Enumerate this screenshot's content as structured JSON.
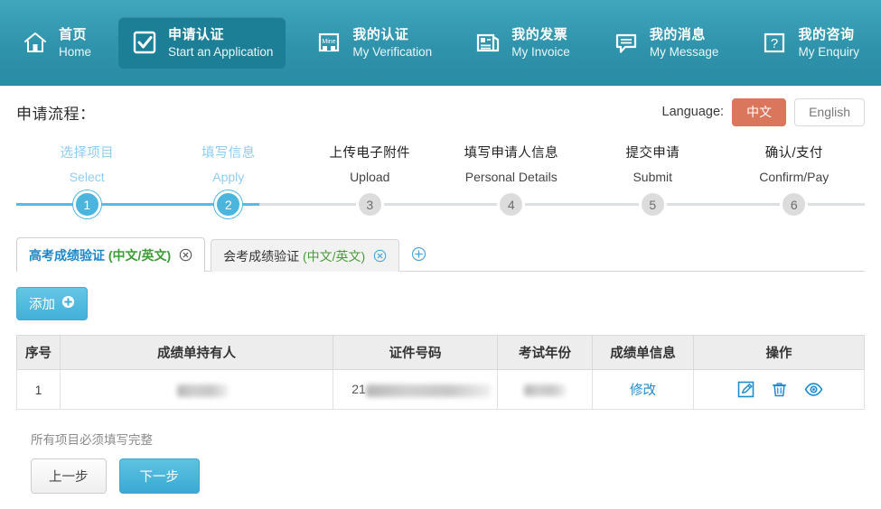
{
  "nav": {
    "items": [
      {
        "cn": "首页",
        "en": "Home",
        "icon": "home-icon",
        "active": false
      },
      {
        "cn": "申请认证",
        "en": "Start an Application",
        "icon": "checkbox-square-icon",
        "active": true
      },
      {
        "cn": "我的认证",
        "en": "My Verification",
        "icon": "mine-card-icon",
        "active": false
      },
      {
        "cn": "我的发票",
        "en": "My Invoice",
        "icon": "invoice-icon",
        "active": false
      },
      {
        "cn": "我的消息",
        "en": "My Message",
        "icon": "speech-bubble-icon",
        "active": false
      },
      {
        "cn": "我的咨询",
        "en": "My Enquiry",
        "icon": "question-square-icon",
        "active": false
      }
    ]
  },
  "header": {
    "page_title": "申请流程：",
    "language_label": "Language:",
    "lang_chinese": "中文",
    "lang_english": "English",
    "active_language": "中文",
    "accent_orange": "#d9765c"
  },
  "stepper": {
    "current": 2,
    "steps": [
      {
        "num": "1",
        "cn": "选择项目",
        "en": "Select",
        "state": "done"
      },
      {
        "num": "2",
        "cn": "填写信息",
        "en": "Apply",
        "state": "done"
      },
      {
        "num": "3",
        "cn": "上传电子附件",
        "en": "Upload",
        "state": "todo"
      },
      {
        "num": "4",
        "cn": "填写申请人信息",
        "en": "Personal Details",
        "state": "todo"
      },
      {
        "num": "5",
        "cn": "提交申请",
        "en": "Submit",
        "state": "todo"
      },
      {
        "num": "6",
        "cn": "确认/支付",
        "en": "Confirm/Pay",
        "state": "todo"
      }
    ],
    "active_color": "#4cb5dd",
    "inactive_color": "#dcdcdc"
  },
  "tabs": {
    "items": [
      {
        "name": "高考成绩验证",
        "sub": "(中文/英文)",
        "active": true
      },
      {
        "name": "会考成绩验证",
        "sub": "(中文/英文)",
        "active": false
      }
    ],
    "add_tab_icon": "plus-circle-icon"
  },
  "toolbar": {
    "add_label": "添加",
    "add_icon": "plus-circle-icon"
  },
  "table": {
    "headers": [
      "序号",
      "成绩单持有人",
      "证件号码",
      "考试年份",
      "成绩单信息",
      "操作"
    ],
    "rows": [
      {
        "index": "1",
        "holder": "",
        "holder_redacted": true,
        "id_prefix": "21",
        "id_redacted": true,
        "year": "",
        "year_redacted": true,
        "info_link": "修改",
        "actions": [
          "edit-icon",
          "delete-icon",
          "view-icon"
        ]
      }
    ],
    "action_color": "#1e8bcd"
  },
  "footer": {
    "note": "所有项目必须填写完整",
    "prev_label": "上一步",
    "next_label": "下一步"
  }
}
